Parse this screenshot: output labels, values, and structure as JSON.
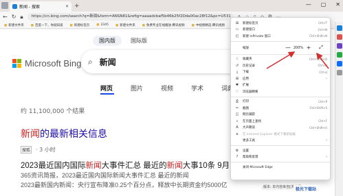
{
  "browser": {
    "tab_title": "新闻 - 搜索",
    "tab_close": "✕",
    "new_tab": "+",
    "url": "https://cn.bing.com/search?q=新闻&form=ANSN81&refig=aaaadcbaf5b46b25f2Dda00ac28f12&pc=U531",
    "window_buttons": [
      "—",
      "▢",
      "✕"
    ]
  },
  "favorites": [
    "新建文件夹",
    "百度一下，你就知道",
    "新建标签页",
    "2345",
    "新建文件夹",
    "免费专业在线播放-腾讯视频",
    "中视频精选-腾讯视频"
  ],
  "page": {
    "scopes": [
      "国内版",
      "国际版"
    ],
    "logo_text": "Microsoft Bing",
    "search_query": "新闻",
    "nav_tabs": [
      "网页",
      "图片",
      "视频",
      "学术",
      "词典"
    ],
    "results_count": "约 11,100,000 个结果",
    "result_title_hl": "新闻",
    "result_title_rest": "的最新相关信息",
    "result_source": "搜狐",
    "result_time": "· 3 小时",
    "news_title_a": "2023最近国内国际",
    "news_title_hl1": "新闻",
    "news_title_b": "大事件汇总 最近的",
    "news_title_hl2": "新闻",
    "news_title_c": "大事10条 9月",
    "news_snip1": "365资讯简报，2023最近国内国际新闻大事件汇总 最近的新闻",
    "news_snip2": "2023最新国内新闻：央行宣布降准0.25个百分点，释放中长期资金约5000亿"
  },
  "menu": {
    "items_top": [
      {
        "label": "新建标签页",
        "shortcut": "Ctrl+T",
        "icon": "⊞"
      },
      {
        "label": "新建窗口",
        "shortcut": "Ctrl+N",
        "icon": "▭"
      },
      {
        "label": "新建 InPrivate 窗口",
        "shortcut": "Ctrl+Shift+N",
        "icon": "◰"
      }
    ],
    "zoom_label": "缩放",
    "zoom_minus": "—",
    "zoom_value": "200%",
    "zoom_plus": "+",
    "zoom_fullscreen": "⤢",
    "items_mid": [
      {
        "label": "收藏夹",
        "shortcut": "Ctrl+Shift+O",
        "icon": "☆"
      },
      {
        "label": "历史记录",
        "shortcut": "Ctrl+H",
        "icon": "↺"
      },
      {
        "label": "下载",
        "shortcut": "Ctrl+J",
        "icon": "⤓"
      },
      {
        "label": "应用",
        "shortcut": "›",
        "icon": "⊞"
      },
      {
        "label": "扩展",
        "shortcut": "",
        "icon": "✱"
      },
      {
        "label": "浏览器精要",
        "shortcut": "",
        "icon": "♡"
      }
    ],
    "items_tools": [
      {
        "label": "打印",
        "shortcut": "Ctrl+P",
        "icon": "⎙"
      },
      {
        "label": "截图",
        "shortcut": "Ctrl+Shift+S",
        "icon": "✂"
      },
      {
        "label": "网页捕获",
        "shortcut": "",
        "icon": "◫"
      },
      {
        "label": "在页面上查找",
        "shortcut": "Ctrl+F",
        "icon": "⌕"
      },
      {
        "label": "大声朗读",
        "shortcut": "Ctrl+Shift+U",
        "icon": "A"
      },
      {
        "label": "在 Internet Explorer 模式下重新加载",
        "shortcut": "",
        "icon": "e",
        "disabled": true
      },
      {
        "label": "更多工具",
        "shortcut": "›",
        "icon": ""
      }
    ],
    "items_bottom": [
      {
        "label": "设置",
        "shortcut": "",
        "icon": "⚙"
      },
      {
        "label": "帮助和反馈",
        "shortcut": "›",
        "icon": "?"
      }
    ],
    "close_label": "关闭 Microsoft Edge"
  },
  "watermark": {
    "left_text": "版本: 本内容来自[浏览器]",
    "brand": "极光下载站"
  },
  "colors": {
    "accent_red": "#d32f2f",
    "bing_link": "#1a0dab",
    "nav_underline": "#174ae4"
  }
}
